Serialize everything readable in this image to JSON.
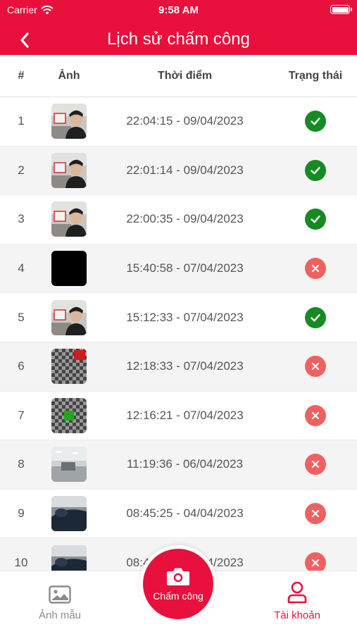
{
  "status_bar": {
    "carrier": "Carrier",
    "time": "9:58 AM"
  },
  "header": {
    "title": "Lịch sử chấm công"
  },
  "table": {
    "columns": {
      "index": "#",
      "image": "Ảnh",
      "time": "Thời điểm",
      "status": "Trạng thái"
    },
    "rows": [
      {
        "index": "1",
        "time": "22:04:15 - 09/04/2023",
        "status": "success",
        "thumb": "selfie"
      },
      {
        "index": "2",
        "time": "22:01:14 - 09/04/2023",
        "status": "success",
        "thumb": "selfie"
      },
      {
        "index": "3",
        "time": "22:00:35 - 09/04/2023",
        "status": "success",
        "thumb": "selfie"
      },
      {
        "index": "4",
        "time": "15:40:58 - 07/04/2023",
        "status": "failed",
        "thumb": "black"
      },
      {
        "index": "5",
        "time": "15:12:33 - 07/04/2023",
        "status": "success",
        "thumb": "selfie"
      },
      {
        "index": "6",
        "time": "12:18:33 - 07/04/2023",
        "status": "failed",
        "thumb": "checker-red"
      },
      {
        "index": "7",
        "time": "12:16:21 - 07/04/2023",
        "status": "failed",
        "thumb": "checker-green"
      },
      {
        "index": "8",
        "time": "11:19:36 - 06/04/2023",
        "status": "failed",
        "thumb": "office"
      },
      {
        "index": "9",
        "time": "08:45:25 - 04/04/2023",
        "status": "failed",
        "thumb": "dark-person"
      },
      {
        "index": "10",
        "time": "08:45:25 - 04/04/2023",
        "status": "failed",
        "thumb": "dark-person"
      }
    ]
  },
  "tabbar": {
    "left_label": "Ảnh mẫu",
    "center_label": "Chấm công",
    "right_label": "Tài khoản"
  },
  "colors": {
    "brand_red": "#e8103c",
    "success_green": "#168a23",
    "failed_red": "#ef6161",
    "inactive_gray": "#8a8a8a"
  },
  "icons": {
    "back": "chevron-left-icon",
    "gallery": "image-icon",
    "camera": "camera-icon",
    "account": "user-icon",
    "success": "check-circle-icon",
    "failed": "x-circle-icon"
  }
}
